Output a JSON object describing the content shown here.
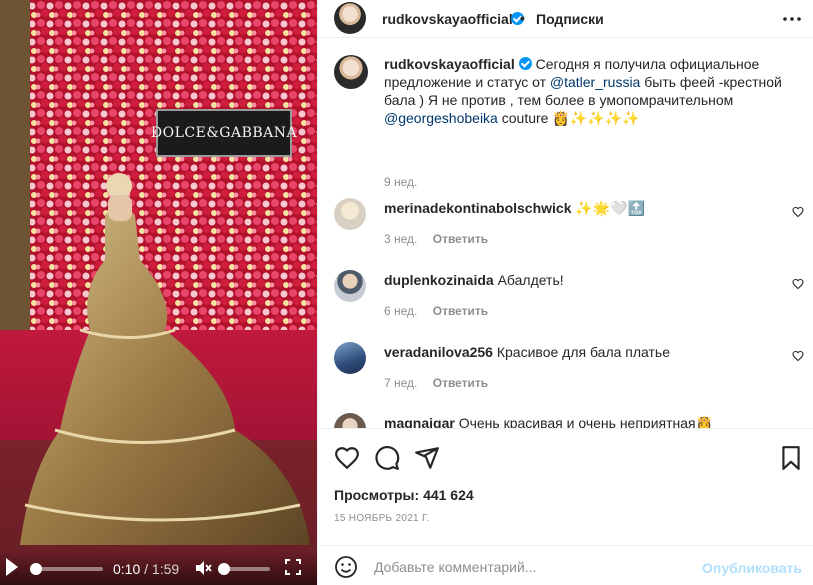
{
  "media": {
    "brand_sign": "DOLCE&GABBANA",
    "controls": {
      "current_time": "0:10",
      "separator": "/",
      "duration": "1:59",
      "progress": 0.08,
      "volume": 0.0
    }
  },
  "header": {
    "username": "rudkovskayaofficial",
    "separator": "•",
    "follow_label": "Подписки"
  },
  "caption": {
    "username": "rudkovskayaofficial",
    "text_1": "Сегодня я получила официальное предложение и статус от",
    "mention_1": "@tatler_russia",
    "text_2": "быть феей -крестной бала ) Я не против , тем более в умопомрачительном",
    "mention_2": "@georgeshobeika",
    "text_3": "couture 👸✨✨✨✨",
    "age": "9 нед."
  },
  "comments": [
    {
      "username": "merinadekontinabolschwick",
      "text": "✨🌟🤍🔝",
      "age": "3 нед.",
      "reply_label": "Ответить"
    },
    {
      "username": "duplenkozinaida",
      "text": "Абалдеть!",
      "age": "6 нед.",
      "reply_label": "Ответить"
    },
    {
      "username": "veradanilova256",
      "text": "Красивое для бала платье",
      "age": "7 нед.",
      "reply_label": "Ответить"
    },
    {
      "username": "magnaigar",
      "text": "Очень красивая и очень неприятная👸",
      "age": "",
      "reply_label": ""
    }
  ],
  "stats": {
    "views_label": "Просмотры:",
    "views_value": "441 624",
    "date": "15 НОЯБРЬ 2021 Г."
  },
  "composer": {
    "placeholder": "Добавьте комментарий...",
    "post_label": "Опубликовать"
  }
}
